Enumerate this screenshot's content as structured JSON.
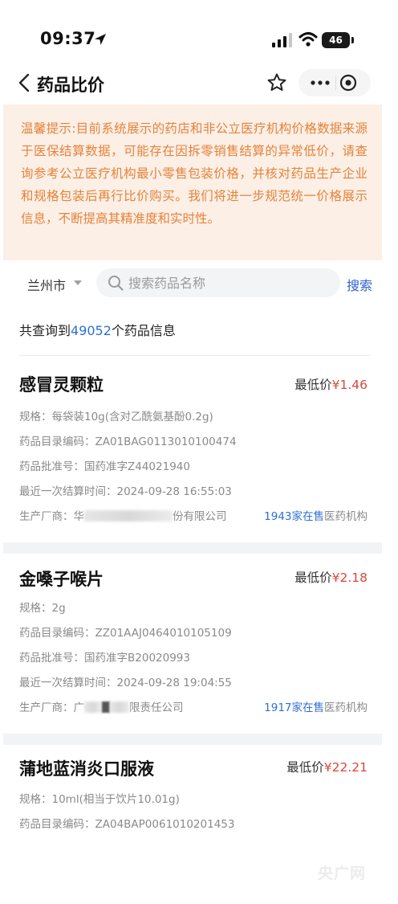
{
  "status_bar": {
    "time": "09:37",
    "battery": "46"
  },
  "nav": {
    "title": "药品比价"
  },
  "notice": {
    "text": "温馨提示:目前系统展示的药店和非公立医疗机构价格数据来源于医保结算数据，可能存在因拆零销售结算的异常低价，请查询参考公立医疗机构最小零售包装价格，并核对药品生产企业和规格包装后再行比价购买。我们将进一步规范统一价格展示信息，不断提高其精准度和实时性。"
  },
  "search": {
    "city": "兰州市",
    "placeholder": "搜索药品名称",
    "button": "搜索"
  },
  "result": {
    "prefix": "共查询到",
    "count": "49052",
    "suffix": "个药品信息"
  },
  "drugs": [
    {
      "name": "感冒灵颗粒",
      "price_label": "最低价",
      "price": "¥1.46",
      "spec_label": "规格：",
      "spec": "每袋装10g(含对乙酰氨基酚0.2g)",
      "code_label": "药品目录编码：",
      "code": "ZA01BAG0113010100474",
      "approval_label": "药品批准号：",
      "approval": "国药准字Z44021940",
      "settle_label": "最近一次结算时间：",
      "settle_time": "2024-09-28 16:55:03",
      "maker_label": "生产厂商：",
      "maker_visible_start": "华",
      "maker_visible_end": "份有限公司",
      "stores_count": "1943家在售",
      "stores_suffix": "医药机构"
    },
    {
      "name": "金嗓子喉片",
      "price_label": "最低价",
      "price": "¥2.18",
      "spec_label": "规格：",
      "spec": "2g",
      "code_label": "药品目录编码：",
      "code": "ZZ01AAJ0464010105109",
      "approval_label": "药品批准号：",
      "approval": "国药准字B20020993",
      "settle_label": "最近一次结算时间：",
      "settle_time": "2024-09-28 19:04:55",
      "maker_label": "生产厂商：",
      "maker_visible_start": "广",
      "maker_visible_end": "限责任公司",
      "stores_count": "1917家在售",
      "stores_suffix": "医药机构"
    },
    {
      "name": "蒲地蓝消炎口服液",
      "price_label": "最低价",
      "price": "¥22.21",
      "spec_label": "规格：",
      "spec": "10ml(相当于饮片10.01g)",
      "code_label": "药品目录编码：",
      "code": "ZA04BAP0061010201453"
    }
  ],
  "watermark": {
    "text": "央广网"
  },
  "colors": {
    "accent": "#2f6fd6",
    "price": "#d9473a",
    "notice_bg": "#fcefe6",
    "notice_text": "#e5833a"
  },
  "icons": [
    "location-arrow-icon",
    "signal-icon",
    "wifi-icon",
    "battery-icon",
    "back-icon",
    "star-icon",
    "more-icon",
    "target-icon",
    "chevron-down-icon",
    "search-icon"
  ]
}
